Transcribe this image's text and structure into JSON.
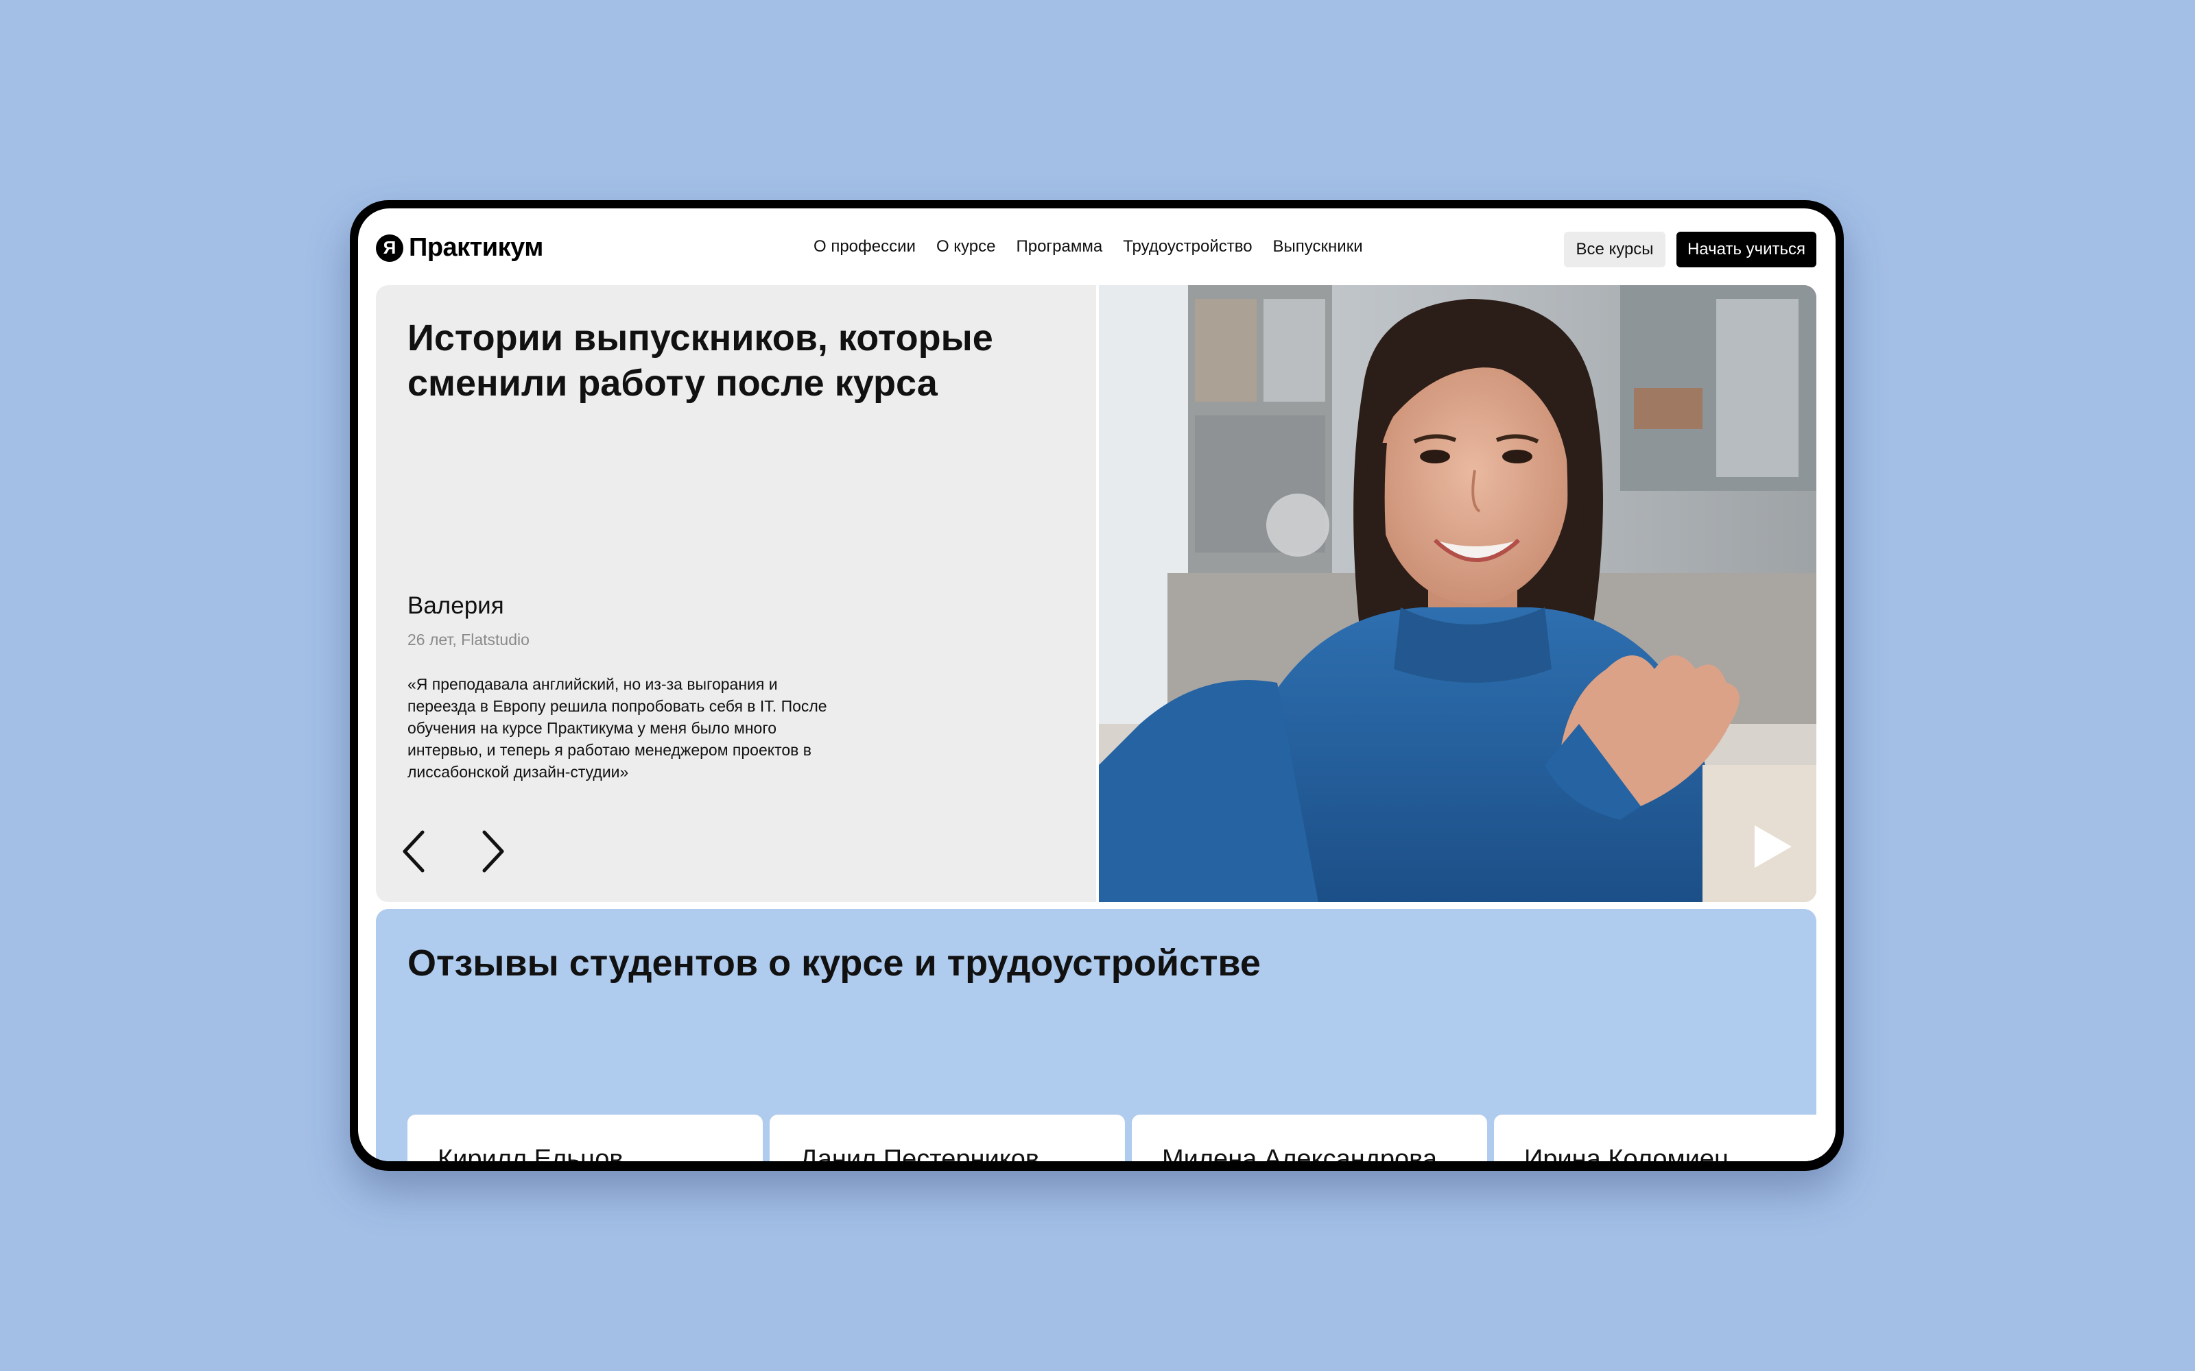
{
  "logo": {
    "mark": "Я",
    "text": "Практикум"
  },
  "nav": [
    {
      "label": "О профессии"
    },
    {
      "label": "О курсе"
    },
    {
      "label": "Программа"
    },
    {
      "label": "Трудоустройство"
    },
    {
      "label": "Выпускники"
    }
  ],
  "header": {
    "all_courses_label": "Все курсы",
    "start_label": "Начать учиться"
  },
  "hero": {
    "title": "Истории выпускников, которые сменили работу после курса",
    "person": {
      "name": "Валерия",
      "meta": "26 лет, Flatstudio",
      "quote": "«Я преподавала английский, но из-за выгорания и переезда в Европу решила попробовать себя в IT. После обучения на курсе Практикума у меня было много интервью, и теперь я работаю менеджером проектов в лиссабонской дизайн-студии»"
    },
    "icons": {
      "prev": "chevron-left-icon",
      "next": "chevron-right-icon",
      "play": "play-icon"
    }
  },
  "reviews": {
    "title": "Отзывы студентов о курсе и трудоустройстве",
    "cards": [
      {
        "name": "Кирилл Ельцов"
      },
      {
        "name": "Данил Пестерников"
      },
      {
        "name": "Милена Александрова"
      },
      {
        "name": "Ирина Коломиец"
      }
    ]
  },
  "colors": {
    "page_background": "#a3bfe6",
    "hero_left_background": "#ededed",
    "reviews_background": "#afcbee",
    "primary_button": "#000000",
    "secondary_button": "#ececec"
  }
}
